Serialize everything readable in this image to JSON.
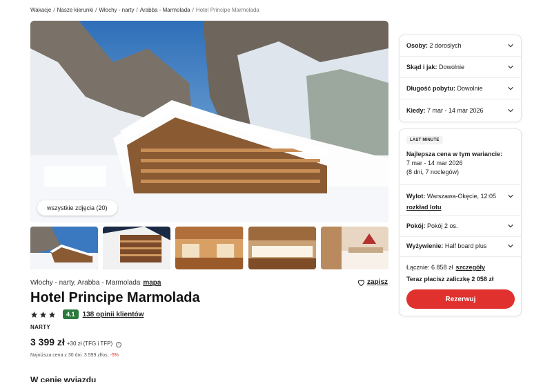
{
  "breadcrumb": [
    "Wakacje",
    "Nasze kierunki",
    "Włochy - narty",
    "Arabba - Marmolada",
    "Hotel Principe Marmolada"
  ],
  "gallery": {
    "all_photos_label": "wszystkie zdjęcia (20)"
  },
  "hotel": {
    "location": "Włochy - narty, Arabba - Marmolada",
    "map_label": "mapa",
    "save_label": "zapisz",
    "name": "Hotel Principe Marmolada",
    "stars": 3,
    "score": "4.1",
    "reviews_label": "138 opinii klientów",
    "category": "NARTY",
    "price": "3 399 zł",
    "price_extra": "+30 zł (TFG i TFP)",
    "lowest_price_note": "Najniższa cena z 30 dni: 3 599 zł/os.",
    "lowest_price_discount": "-5%",
    "section_heading": "W cenie wyjazdu"
  },
  "booking": {
    "options": [
      {
        "label": "Osoby:",
        "value": "2 dorosłych"
      },
      {
        "label": "Skąd i jak:",
        "value": "Dowolnie"
      },
      {
        "label": "Długość pobytu:",
        "value": "Dowolnie"
      },
      {
        "label": "Kiedy:",
        "value": "7 mar - 14 mar 2026"
      }
    ],
    "badge": "LAST MINUTE",
    "best_price_title": "Najlepsza cena w tym wariancie:",
    "best_price_dates": "7 mar - 14 mar 2026",
    "best_price_nights": "(8 dni, 7 noclegów)",
    "flight_label": "Wylot:",
    "flight_value": "Warszawa-Okęcie, 12:05",
    "flight_details_link": "rozkład lotu",
    "room_label": "Pokój:",
    "room_value": "Pokój 2 os.",
    "board_label": "Wyżywienie:",
    "board_value": "Half board plus",
    "total_label": "Łącznie: 6 858 zł",
    "total_details_link": "szczegóły",
    "deposit_label": "Teraz płacisz zaliczkę 2 058 zł",
    "reserve_button": "Rezerwuj"
  },
  "colors": {
    "accent": "#e0312f",
    "score_bg": "#2b7a3b"
  }
}
